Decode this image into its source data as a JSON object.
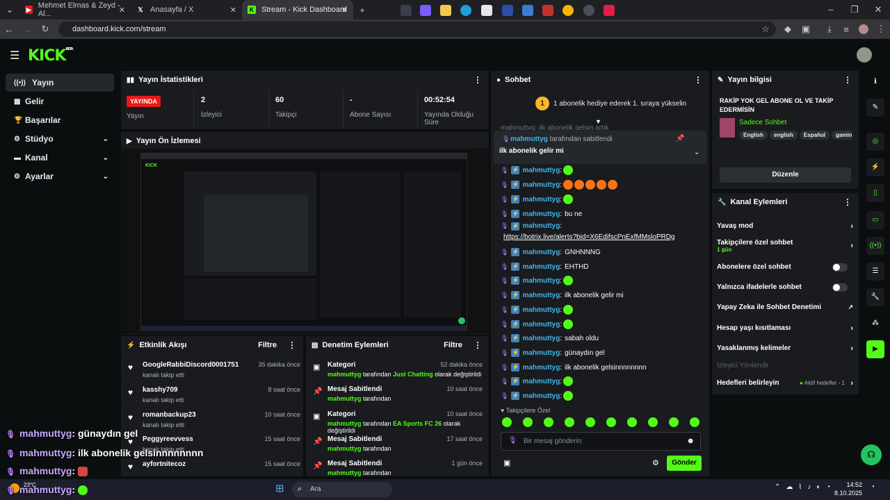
{
  "browser": {
    "tabs": [
      {
        "label": "Mehmet Elmas & Zeyd - Al...",
        "color": "#e91916"
      },
      {
        "label": "Anasayfa / X",
        "color": "#000000"
      },
      {
        "label": "Stream - Kick Dashboard",
        "color": "#53fc18"
      }
    ],
    "url": "dashboard.kick.com/stream"
  },
  "logo": "KICK",
  "logo_tag": "BETA",
  "sidebar": [
    {
      "label": "Yayın",
      "icon": "broadcast-icon",
      "active": true
    },
    {
      "label": "Gelir",
      "icon": "grid-icon"
    },
    {
      "label": "Başarılar",
      "icon": "trophy-icon"
    },
    {
      "label": "Stüdyo",
      "icon": "gear-icon",
      "chev": true
    },
    {
      "label": "Kanal",
      "icon": "channel-icon",
      "chev": true
    },
    {
      "label": "Ayarlar",
      "icon": "settings-icon",
      "chev": true
    }
  ],
  "stats": {
    "title": "Yayın İstatistikleri",
    "live_badge": "YAYINDA",
    "live_label": "Yayın",
    "items": [
      {
        "value": "2",
        "label": "İzleyici"
      },
      {
        "value": "60",
        "label": "Takipçi"
      },
      {
        "value": "-",
        "label": "Abone Sayısı"
      },
      {
        "value": "00:52:54",
        "label": "Yayında Olduğu Süre"
      }
    ]
  },
  "preview": {
    "title": "Yayın Ön İzlemesi"
  },
  "activity": {
    "title": "Etkinlik Akışı",
    "filter": "Filtre",
    "items": [
      {
        "name": "GoogleRabbiDiscord0001751",
        "sub": "kanalı takip etti",
        "time": "35 dakika önce"
      },
      {
        "name": "kasshy709",
        "sub": "kanalı takip etti",
        "time": "8 saat önce"
      },
      {
        "name": "romanbackup23",
        "sub": "kanalı takip etti",
        "time": "10 saat önce"
      },
      {
        "name": "Peggyreevvess",
        "sub": "kanalı takip etti",
        "time": "15 saat önce"
      },
      {
        "name": "ayfortnitecoz",
        "sub": "",
        "time": "15 saat önce"
      }
    ]
  },
  "moderation": {
    "title": "Denetim Eylemleri",
    "filter": "Filtre",
    "items": [
      {
        "name": "Kategori",
        "user": "mahmuttyg",
        "mid": "tarafından",
        "cat": "Just Chatting",
        "end": "olarak değiştirildi",
        "time": "52 dakika önce",
        "icon": "category-icon"
      },
      {
        "name": "Mesaj Sabitlendi",
        "user": "mahmuttyg",
        "mid": "tarafından",
        "cat": "",
        "end": "",
        "time": "10 saat önce",
        "icon": "pin-icon"
      },
      {
        "name": "Kategori",
        "user": "mahmuttyg",
        "mid": "tarafından",
        "cat": "EA Sports FC 26",
        "end": "olarak değiştirildi",
        "time": "10 saat önce",
        "icon": "category-icon"
      },
      {
        "name": "Mesaj Sabitlendi",
        "user": "mahmuttyg",
        "mid": "tarafından",
        "cat": "",
        "end": "",
        "time": "17 saat önce",
        "icon": "pin-icon"
      },
      {
        "name": "Mesaj Sabitlendi",
        "user": "mahmuttyg",
        "mid": "tarafından",
        "cat": "",
        "end": "",
        "time": "1 gün önce",
        "icon": "pin-icon"
      }
    ]
  },
  "chat": {
    "title": "Sohbet",
    "gift_banner": "1 abonelik hediye ederek 1. sıraya yükselin",
    "gift_num": "1",
    "pinned_user": "mahmuttyg",
    "pinned_by": "tarafından sabitlendi",
    "pinned_msg": "ilk abonelik gelir mi",
    "partial_top": "mahmuttyg: ilk abonelik gelsin artık",
    "messages": [
      {
        "user": "mahmuttyg",
        "text": "",
        "emotes": 1
      },
      {
        "user": "mahmuttyg",
        "text": "",
        "emotes": 5
      },
      {
        "user": "mahmuttyg",
        "text": "",
        "emotes": 1
      },
      {
        "user": "mahmuttyg",
        "text": "bu ne",
        "emotes": 0
      },
      {
        "user": "mahmuttyg",
        "text": "https://botrix.live/alerts?bid=X6EdifscPnExfMMsloPRDg",
        "emotes": 0,
        "link": true
      },
      {
        "user": "mahmuttyg",
        "text": "GNHNNNG",
        "emotes": 0
      },
      {
        "user": "mahmuttyg",
        "text": "EHTHD",
        "emotes": 0
      },
      {
        "user": "mahmuttyg",
        "text": "",
        "emotes": 1
      },
      {
        "user": "mahmuttyg",
        "text": "ilk abonelik gelir mi",
        "emotes": 0
      },
      {
        "user": "mahmuttyg",
        "text": "",
        "emotes": 1
      },
      {
        "user": "mahmuttyg",
        "text": "",
        "emotes": 1
      },
      {
        "user": "mahmuttyg",
        "text": "sabah oldu",
        "emotes": 0
      },
      {
        "user": "mahmuttyg",
        "text": "günaydın gel",
        "emotes": 0
      },
      {
        "user": "mahmuttyg",
        "text": "ilk abonelik gelsinnnnnnnn",
        "emotes": 0
      },
      {
        "user": "mahmuttyg",
        "text": "",
        "emotes": 1
      },
      {
        "user": "mahmuttyg",
        "text": "",
        "emotes": 1
      }
    ],
    "emote_section": "Takipçilere Özel",
    "placeholder": "Bir mesaj gönderin",
    "send": "Gönder"
  },
  "info": {
    "title": "Yayın bilgisi",
    "stream_title": "RAKİP YOK GEL ABONE OL VE TAKİP EDERMİSİN",
    "category": "Sadece Sohbet",
    "tags": [
      "English",
      "english",
      "Español",
      "gaming"
    ],
    "edit": "Düzenle"
  },
  "channel_actions": {
    "title": "Kanal Eylemleri",
    "items": [
      {
        "label": "Yavaş mod",
        "kind": "arrow"
      },
      {
        "label": "Takipçilere özel sohbet",
        "sub": "1 gün",
        "kind": "arrow"
      },
      {
        "label": "Abonelere özel sohbet",
        "kind": "toggle"
      },
      {
        "label": "Yalnızca ifadelerle sohbet",
        "kind": "toggle"
      },
      {
        "label": "Yapay Zeka ile Sohbet Denetimi",
        "kind": "ext"
      },
      {
        "label": "Hesap yaşı kısıtlaması",
        "kind": "arrow"
      },
      {
        "label": "Yasaklanmış kelimeler",
        "kind": "arrow"
      },
      {
        "label": "İzleyici Yönlendir",
        "kind": "none",
        "dim": true
      },
      {
        "label": "Hedefleri belirleyin",
        "kind": "goal",
        "extra": "Aktif hedefler - 1"
      }
    ]
  },
  "overlay": [
    {
      "user": "mahmuttyg",
      "text": ": günaydın gel"
    },
    {
      "user": "mahmuttyg",
      "text": ": ilk abonelik gelsinnnnnnnn"
    },
    {
      "user": "mahmuttyg",
      "text": ":"
    },
    {
      "user": "mahmuttyg",
      "text": ":"
    }
  ],
  "taskbar": {
    "weather": "23°C",
    "search": "Ara",
    "time": "14:52",
    "date": "8.10.2025"
  }
}
